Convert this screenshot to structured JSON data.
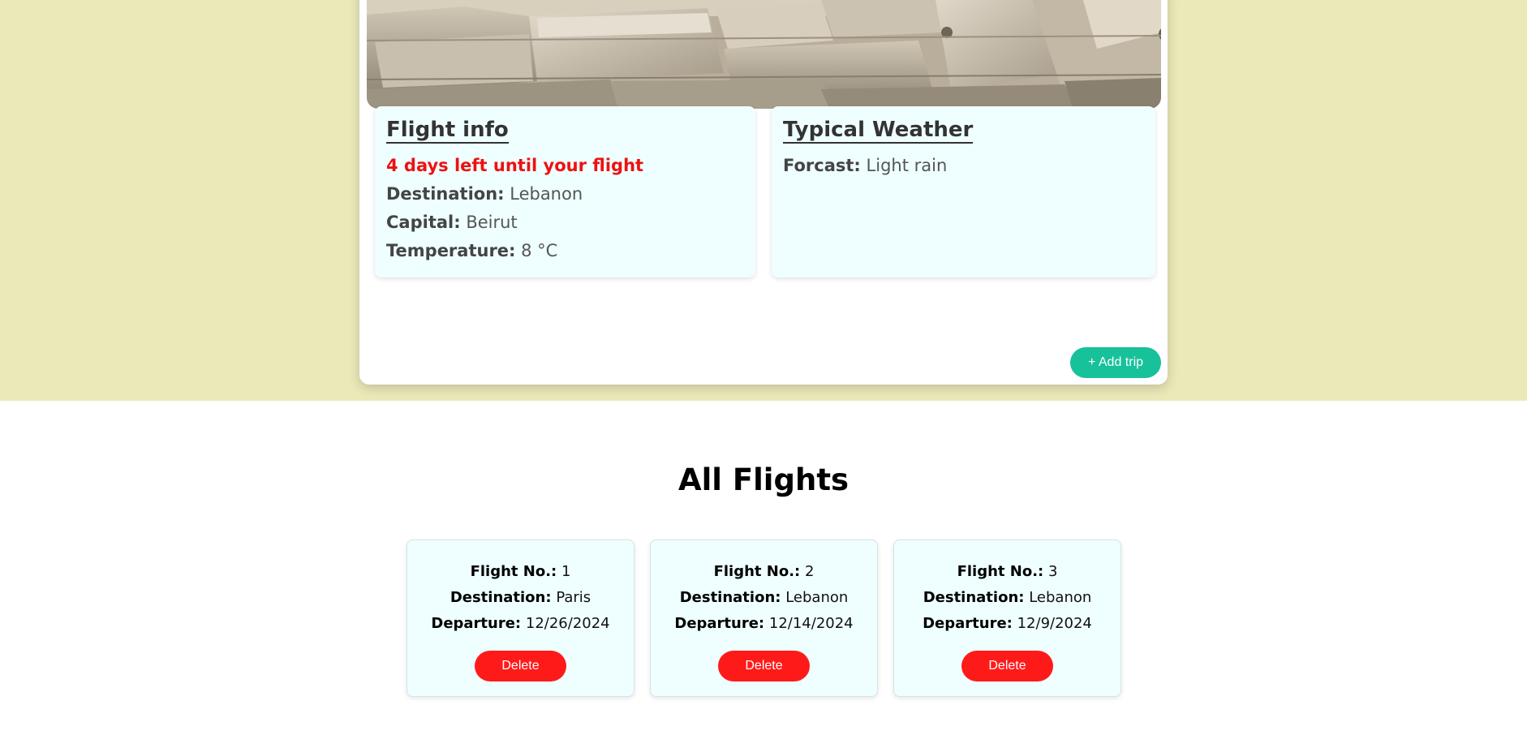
{
  "trip": {
    "hero_alt": "Roman ruins",
    "flight_info": {
      "title": "Flight info",
      "countdown": "4 days left until your flight",
      "destination_label": "Destination:",
      "destination": "Lebanon",
      "capital_label": "Capital:",
      "capital": "Beirut",
      "temperature_label": "Temperature:",
      "temperature": "8 °C"
    },
    "weather": {
      "title": "Typical Weather",
      "forecast_label": "Forcast:",
      "forecast": "Light rain"
    },
    "add_trip_label": "+ Add trip"
  },
  "all_flights": {
    "title": "All Flights",
    "flight_no_label": "Flight No.:",
    "destination_label": "Destination:",
    "departure_label": "Departure:",
    "delete_label": "Delete",
    "flights": [
      {
        "number": "1",
        "destination": "Paris",
        "departure": "12/26/2024"
      },
      {
        "number": "2",
        "destination": "Lebanon",
        "departure": "12/14/2024"
      },
      {
        "number": "3",
        "destination": "Lebanon",
        "departure": "12/9/2024"
      }
    ]
  },
  "colors": {
    "page_band": "#eae9b8",
    "panel_bg": "#efffff",
    "accent_green": "#17c19a",
    "delete_red": "#ff1a1a",
    "countdown_red": "#ee1111"
  }
}
